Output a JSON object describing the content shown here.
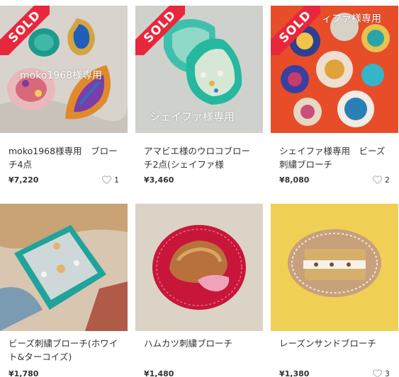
{
  "items": [
    {
      "title": "moko1968様専用　ブローチ4点",
      "price": "¥7,220",
      "likes": "1",
      "sold": true,
      "sold_label": "SOLD",
      "watermark": "moko1968様専用"
    },
    {
      "title": "アマビエ様のウロコブローチ2点(シェイファ様",
      "price": "¥3,460",
      "likes": "",
      "sold": true,
      "sold_label": "SOLD",
      "watermark": "シェイファ様専用"
    },
    {
      "title": "シェイファ様専用　ビーズ刺繍ブローチ",
      "price": "¥8,080",
      "likes": "2",
      "sold": true,
      "sold_label": "SOLD",
      "watermark": "ィファ様専用"
    },
    {
      "title": "ビーズ刺繍ブローチ(ホワイト&ターコイズ)",
      "price": "¥1,780",
      "likes": "",
      "sold": false
    },
    {
      "title": "ハムカツ刺繍ブローチ",
      "price": "¥1,480",
      "likes": "",
      "sold": false
    },
    {
      "title": "レーズンサンドブローチ",
      "price": "¥1,380",
      "likes": "3",
      "sold": false
    }
  ],
  "icons": {
    "like": "heart-outline-icon"
  },
  "colors": {
    "sold_ribbon": "#e9273c",
    "heart": "#c8c8c8"
  }
}
